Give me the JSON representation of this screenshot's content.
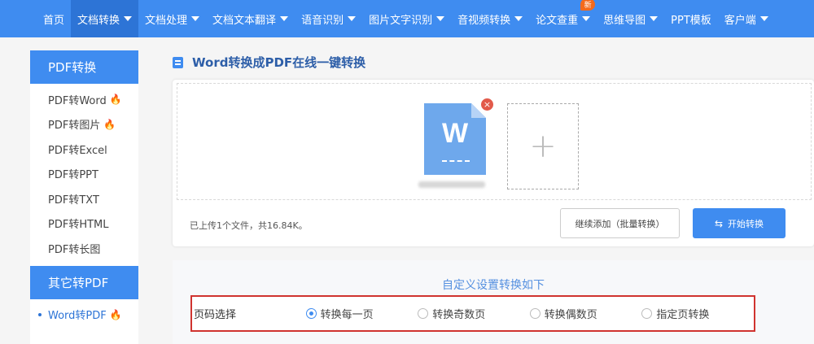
{
  "nav": {
    "items": [
      {
        "label": "首页",
        "dropdown": false
      },
      {
        "label": "文档转换",
        "dropdown": true,
        "active": true
      },
      {
        "label": "文档处理",
        "dropdown": true
      },
      {
        "label": "文档文本翻译",
        "dropdown": true
      },
      {
        "label": "语音识别",
        "dropdown": true
      },
      {
        "label": "图片文字识别",
        "dropdown": true
      },
      {
        "label": "音视频转换",
        "dropdown": true
      },
      {
        "label": "论文查重",
        "dropdown": true,
        "badge": "新"
      },
      {
        "label": "思维导图",
        "dropdown": true
      },
      {
        "label": "PPT模板",
        "dropdown": false
      },
      {
        "label": "客户端",
        "dropdown": true
      }
    ]
  },
  "sidebar": {
    "section1_title": "PDF转换",
    "section1_items": [
      {
        "label": "PDF转Word",
        "hot": true
      },
      {
        "label": "PDF转图片",
        "hot": true
      },
      {
        "label": "PDF转Excel",
        "hot": false
      },
      {
        "label": "PDF转PPT",
        "hot": false
      },
      {
        "label": "PDF转TXT",
        "hot": false
      },
      {
        "label": "PDF转HTML",
        "hot": false
      },
      {
        "label": "PDF转长图",
        "hot": false
      }
    ],
    "section2_title": "其它转PDF",
    "section2_items": [
      {
        "label": "Word转PDF",
        "hot": true,
        "active": true
      }
    ]
  },
  "main": {
    "title": "Word转换成PDF在线一键转换",
    "file_letter": "W",
    "add_symbol": "+",
    "remove_symbol": "×",
    "upload_status": "已上传1个文件，共16.84K。",
    "continue_button": "继续添加（批量转换）",
    "start_button": "开始转换",
    "settings_title": "自定义设置转换如下",
    "page_select_label": "页码选择",
    "page_options": [
      {
        "label": "转换每一页",
        "checked": true
      },
      {
        "label": "转换奇数页",
        "checked": false
      },
      {
        "label": "转换偶数页",
        "checked": false
      },
      {
        "label": "指定页转换",
        "checked": false
      }
    ]
  },
  "colors": {
    "primary": "#3f8cf0",
    "highlight_border": "#d0332f",
    "hot": "#f37b1d"
  }
}
